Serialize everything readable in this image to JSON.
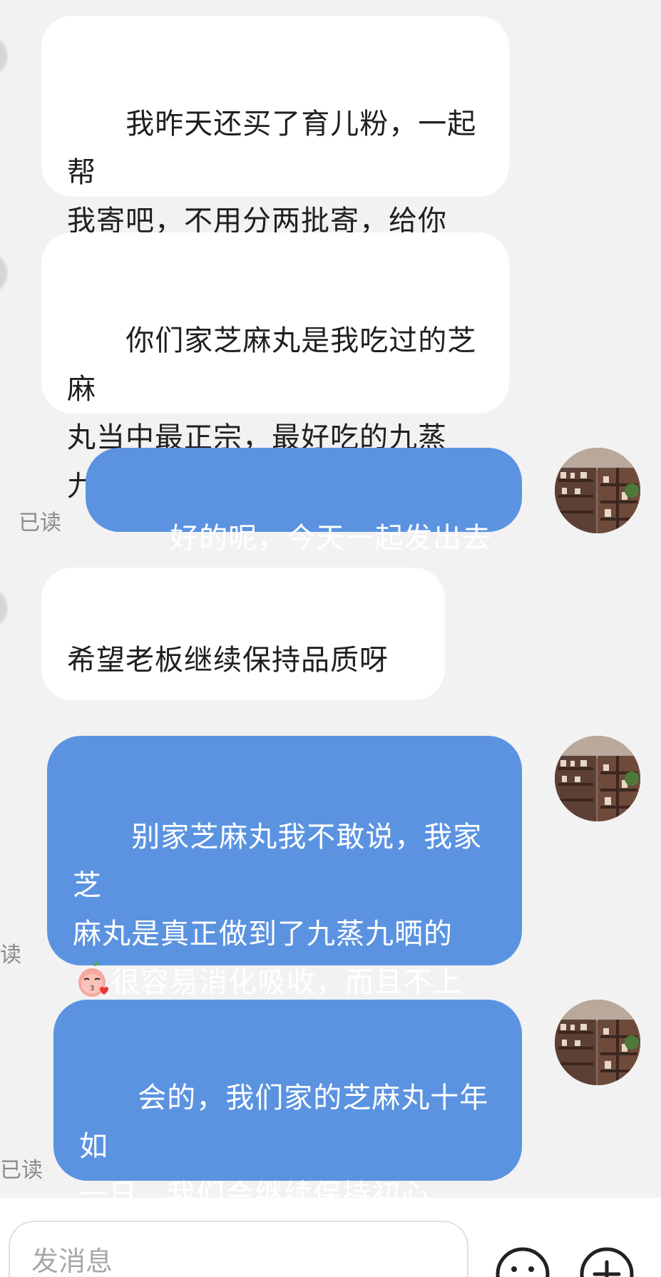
{
  "messages": [
    {
      "side": "incoming",
      "text": "我昨天还买了育儿粉，一起帮\n我寄吧，不用分两批寄，给你\n省点运费"
    },
    {
      "side": "incoming",
      "text": "你们家芝麻丸是我吃过的芝麻\n丸当中最正宗，最好吃的九蒸\n九晒芝麻丸",
      "emoji": "surprised-peach-emoji"
    },
    {
      "side": "outgoing",
      "text": "好的呢，今天一起发出去哈",
      "read_label": "已读"
    },
    {
      "side": "incoming",
      "text": "希望老板继续保持品质呀"
    },
    {
      "side": "outgoing",
      "text_line1": "别家芝麻丸我不敢说，我家芝\n麻丸是真正做到了九蒸九晒的\n",
      "emoji": "kiss-peach-emoji",
      "text_line2": "很容易消化吸收，而且不上\n火",
      "read_label": "读"
    },
    {
      "side": "outgoing",
      "text": "会的，我们家的芝麻丸十年如\n一日，我们会继续保持初心，\n感恩姐妹支持",
      "emoji": "kiss-peach-emoji",
      "read_label": "已读"
    }
  ],
  "composer": {
    "placeholder": "发消息",
    "emoji_button_icon": "smiley-icon",
    "plus_button_icon": "plus-icon"
  },
  "colors": {
    "background": "#f2f2f2",
    "incoming_bubble": "#ffffff",
    "outgoing_bubble": "#5b93e0"
  }
}
